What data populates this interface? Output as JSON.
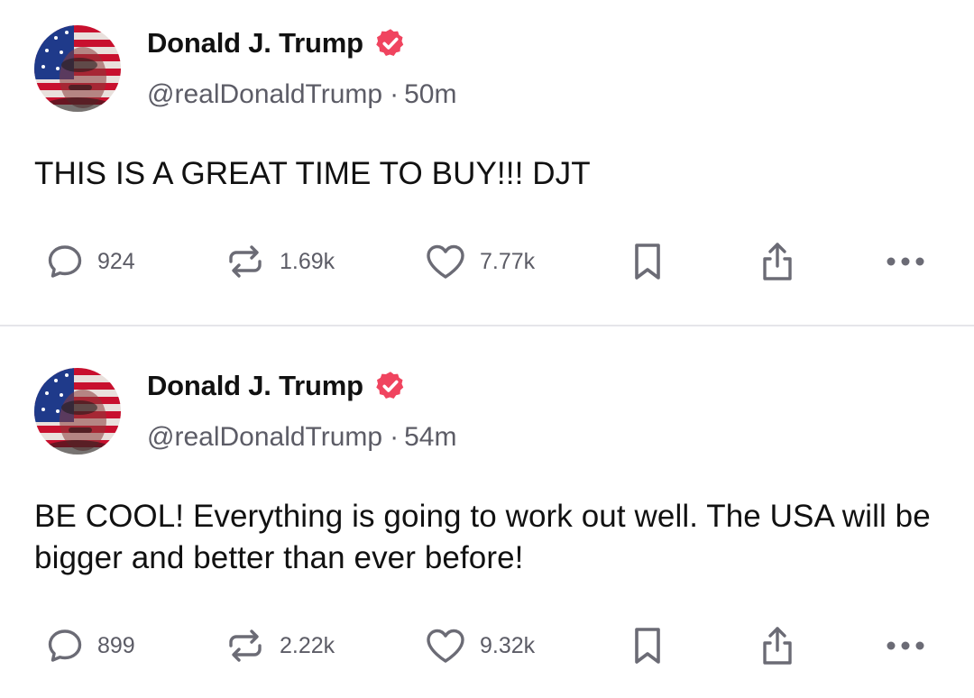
{
  "posts": [
    {
      "author": {
        "display_name": "Donald J. Trump",
        "handle": "@realDonaldTrump",
        "verified": true
      },
      "separator": "·",
      "time": "50m",
      "text": "THIS IS A GREAT TIME TO BUY!!! DJT",
      "stats": {
        "replies": "924",
        "reposts": "1.69k",
        "likes": "7.77k"
      }
    },
    {
      "author": {
        "display_name": "Donald J. Trump",
        "handle": "@realDonaldTrump",
        "verified": true
      },
      "separator": "·",
      "time": "54m",
      "text": "BE COOL! Everything is going to work out well. The USA will be bigger and better than ever before!",
      "stats": {
        "replies": "899",
        "reposts": "2.22k",
        "likes": "9.32k"
      }
    }
  ],
  "icons": {
    "reply": "speech-bubble-icon",
    "repost": "repost-arrows-icon",
    "like": "heart-icon",
    "bookmark": "bookmark-icon",
    "share": "share-upload-icon",
    "more": "more-dots-icon",
    "verified": "verified-badge-icon"
  },
  "colors": {
    "text": "#111111",
    "muted": "#5c5c66",
    "icon": "#6b6b75",
    "verified_badge": "#f0445f",
    "divider": "#e5e5ea"
  }
}
